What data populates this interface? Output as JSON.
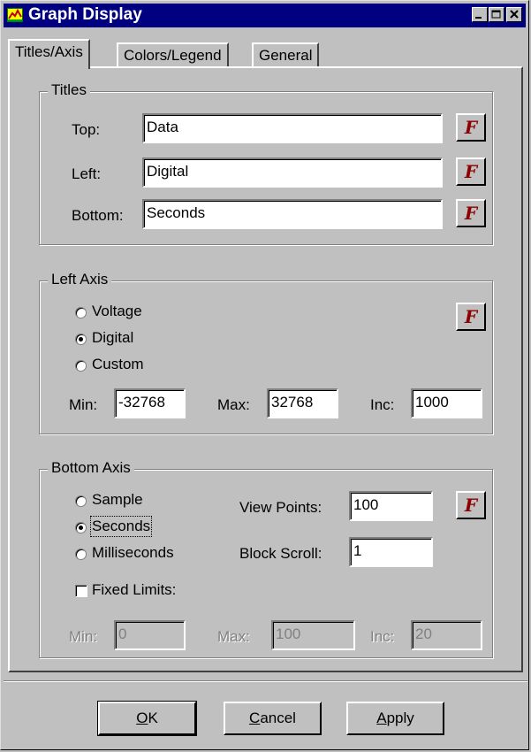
{
  "window": {
    "title": "Graph Display"
  },
  "tabs": [
    {
      "label": "Titles/Axis",
      "active": true
    },
    {
      "label": "Colors/Legend",
      "active": false
    },
    {
      "label": "General",
      "active": false
    }
  ],
  "titles": {
    "legend": "Titles",
    "top_label": "Top:",
    "top_value": "Data",
    "left_label": "Left:",
    "left_value": "Digital",
    "bottom_label": "Bottom:",
    "bottom_value": "Seconds",
    "font_button": "F"
  },
  "left_axis": {
    "legend": "Left Axis",
    "options": [
      "Voltage",
      "Digital",
      "Custom"
    ],
    "selected": "Digital",
    "min_label": "Min:",
    "min_value": "-32768",
    "max_label": "Max:",
    "max_value": "32768",
    "inc_label": "Inc:",
    "inc_value": "1000"
  },
  "bottom_axis": {
    "legend": "Bottom Axis",
    "options": [
      "Sample",
      "Seconds",
      "Milliseconds"
    ],
    "selected": "Seconds",
    "view_points_label": "View Points:",
    "view_points_value": "100",
    "block_scroll_label": "Block Scroll:",
    "block_scroll_value": "1",
    "fixed_limits_label": "Fixed Limits:",
    "fixed_limits_checked": false,
    "min_label": "Min:",
    "min_value": "0",
    "max_label": "Max:",
    "max_value": "100",
    "inc_label": "Inc:",
    "inc_value": "20"
  },
  "buttons": {
    "ok_mnemonic": "O",
    "ok_rest": "K",
    "cancel_mnemonic": "C",
    "cancel_rest": "ancel",
    "apply_mnemonic": "A",
    "apply_rest": "pply"
  },
  "colors": {
    "titlebar": "#000080",
    "face": "#c0c0c0",
    "font_button_text": "#8b0000"
  },
  "icons": [
    "app-icon",
    "minimize-icon",
    "maximize-icon",
    "close-icon"
  ]
}
